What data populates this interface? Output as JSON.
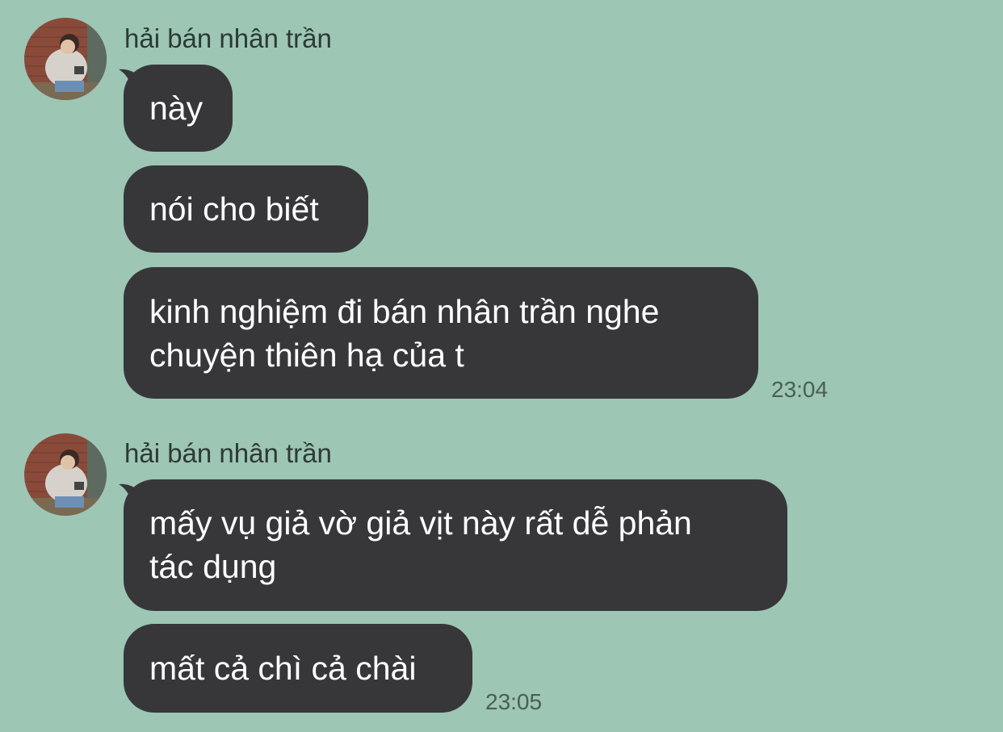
{
  "colors": {
    "background": "#9dc6b5",
    "bubble": "#373739",
    "bubble_text": "#ffffff",
    "sender_text": "#2d3a34",
    "time_text": "#4a5e55"
  },
  "groups": [
    {
      "sender": "hải bán nhân trần",
      "avatar_icon": "user-photo-avatar",
      "messages": [
        {
          "lines": [
            "này"
          ]
        },
        {
          "lines": [
            "nói cho biết"
          ]
        },
        {
          "lines": [
            "kinh nghiệm đi bán nhân trần nghe",
            "chuyện thiên hạ của t"
          ]
        }
      ],
      "time": "23:04"
    },
    {
      "sender": "hải bán nhân trần",
      "avatar_icon": "user-photo-avatar",
      "messages": [
        {
          "lines": [
            "mấy vụ giả vờ giả vịt này rất dễ phản",
            "tác dụng"
          ]
        },
        {
          "lines": [
            "mất cả chì cả chài"
          ]
        }
      ],
      "time": "23:05"
    }
  ]
}
